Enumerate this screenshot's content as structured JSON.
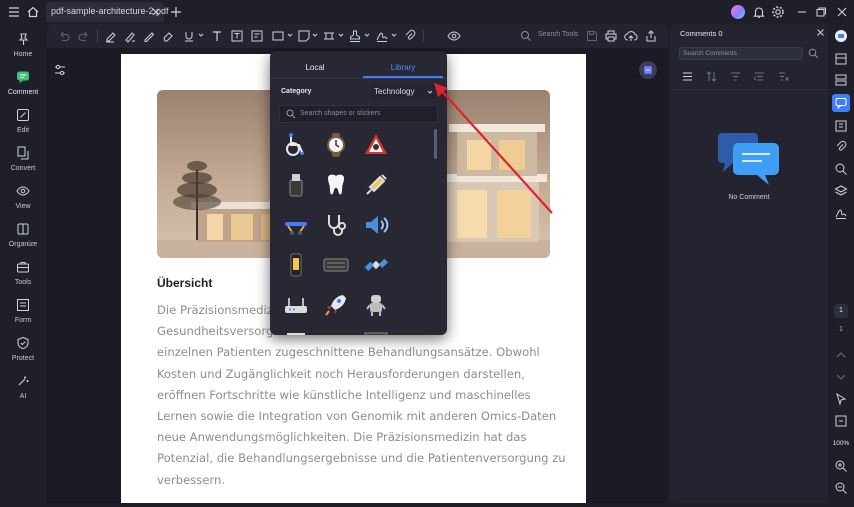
{
  "titlebar": {
    "tab_label": "pdf-sample-architecture-2.pdf"
  },
  "leftnav": {
    "items": [
      {
        "label": "Home",
        "icon": "pin-icon"
      },
      {
        "label": "Comment",
        "icon": "comment-icon"
      },
      {
        "label": "Edit",
        "icon": "edit-icon"
      },
      {
        "label": "Convert",
        "icon": "convert-icon"
      },
      {
        "label": "View",
        "icon": "eye-icon"
      },
      {
        "label": "Organize",
        "icon": "pages-icon"
      },
      {
        "label": "Tools",
        "icon": "toolbox-icon"
      },
      {
        "label": "Form",
        "icon": "form-icon"
      },
      {
        "label": "Protect",
        "icon": "shield-icon"
      },
      {
        "label": "AI",
        "icon": "sparkle-icon"
      }
    ],
    "more": "…"
  },
  "toolbar": {
    "search_tools_label": "Search Tools"
  },
  "document": {
    "section_title": "Übersicht",
    "body_lines": [
      "Die Präzisionsmedizin                                        der",
      "Gesundheitsversorg                                   rte und auf den",
      "einzelnen Patienten zugeschnittene Behandlungsansätze. Obwohl",
      "Kosten und Zugänglichkeit noch Herausforderungen darstellen,",
      "eröffnen Fortschritte wie künstliche Intelligenz und maschinelles",
      "Lernen sowie die Integration von Genomik mit anderen Omics-Daten",
      "neue Anwendungsmöglichkeiten. Die Präzisionsmedizin hat das",
      "Potenzial, die Behandlungsergebnisse und die Patientenversorgung zu",
      "verbessern."
    ]
  },
  "sticker_panel": {
    "tabs": [
      "Local",
      "Library"
    ],
    "active_tab": "Library",
    "category_label": "Category",
    "category_value": "Technology",
    "search_placeholder": "Search shapes or stickers",
    "stickers": [
      "wheelchair-icon",
      "watch-icon",
      "hazard-sign-icon",
      "usb-drive-icon",
      "tooth-icon",
      "syringe-icon",
      "stretcher-icon",
      "stethoscope-icon",
      "speaker-icon",
      "phone-icon",
      "keyboard-icon",
      "satellite-icon",
      "router-icon",
      "rocket-icon",
      "robot-icon"
    ]
  },
  "comments": {
    "title": "Comments 0",
    "search_placeholder": "Search Comments",
    "empty_label": "No Comment"
  },
  "rightrail": {
    "page_current": "1",
    "page_total": "1",
    "zoom": "100%"
  },
  "colors": {
    "accent": "#3f7cff",
    "annotation_arrow": "#e0222e",
    "panel_bg": "#272834"
  }
}
